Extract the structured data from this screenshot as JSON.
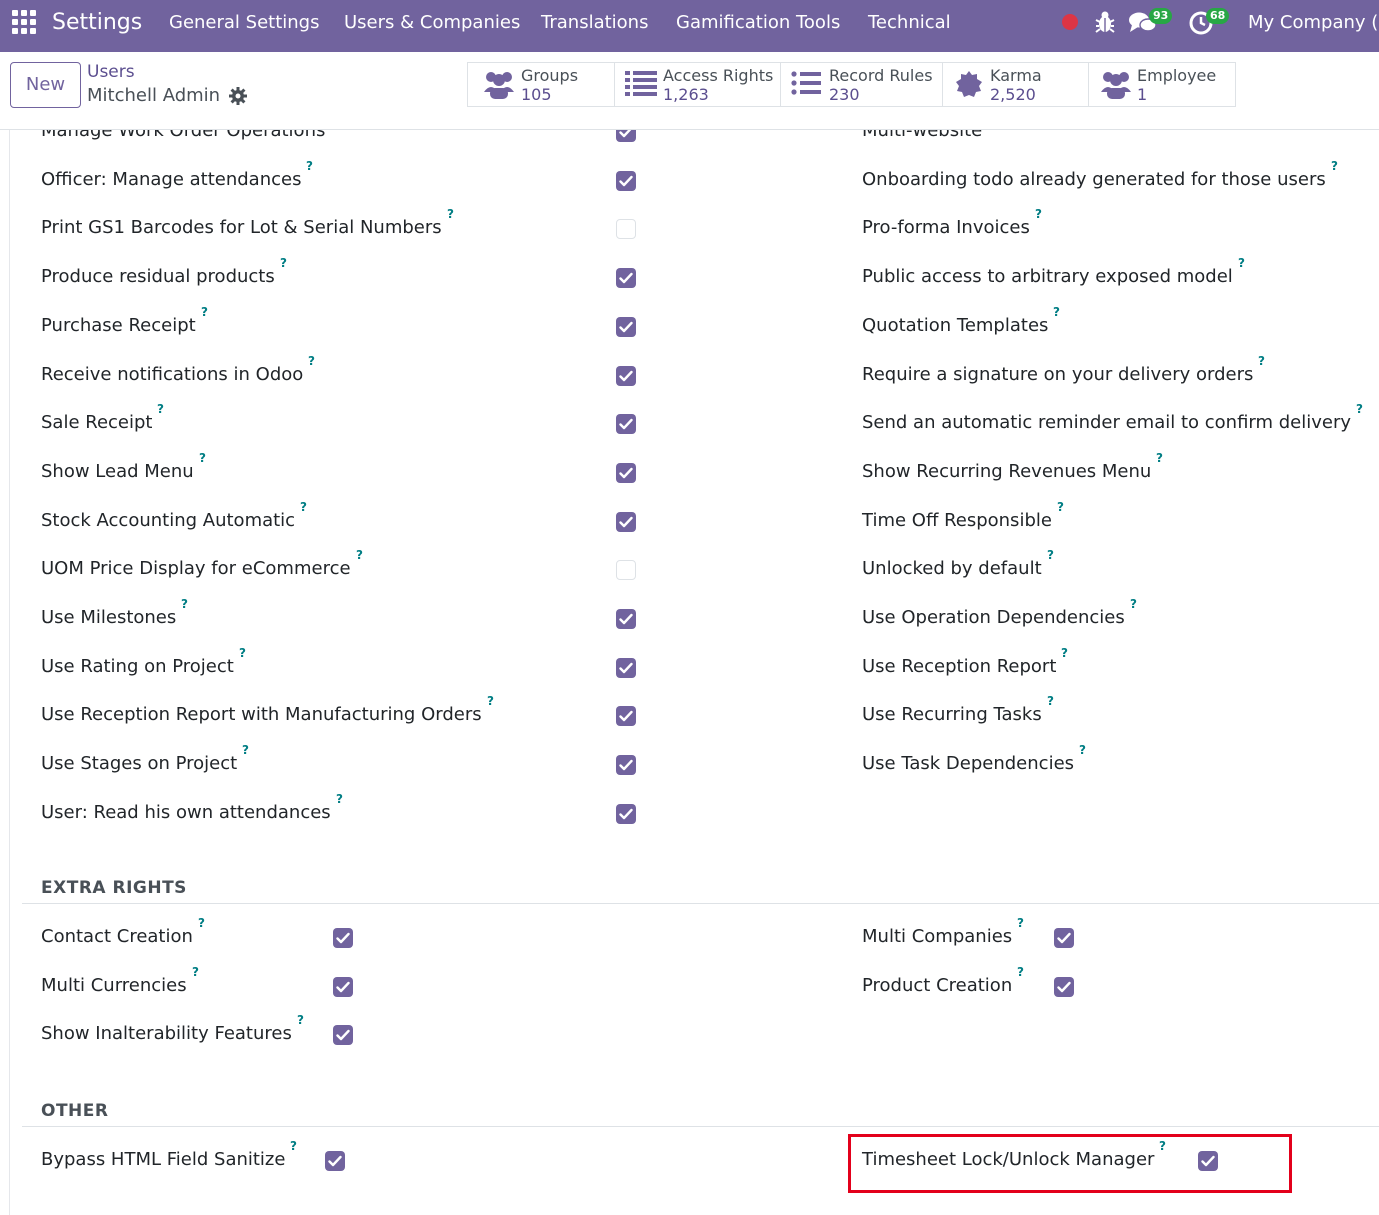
{
  "navbar": {
    "brand": "Settings",
    "menu": [
      "General Settings",
      "Users & Companies",
      "Translations",
      "Gamification Tools",
      "Technical"
    ],
    "messages_count": "93",
    "activities_count": "68",
    "company": "My Company (San Francisco)",
    "colors": {
      "bar": "#71639e",
      "badge": "#28a745",
      "record": "#dc3545"
    },
    "icons": [
      "apps-grid-icon",
      "record-icon",
      "bug-icon",
      "chat-icon",
      "activity-clock-icon"
    ]
  },
  "control": {
    "new_label": "New",
    "breadcrumb_parent": "Users",
    "breadcrumb_current": "Mitchell Admin",
    "stats": [
      {
        "label": "Groups",
        "value": "105",
        "icon": "users-icon"
      },
      {
        "label": "Access Rights",
        "value": "1,263",
        "icon": "list-icon"
      },
      {
        "label": "Record Rules",
        "value": "230",
        "icon": "list-icon"
      },
      {
        "label": "Karma",
        "value": "2,520",
        "icon": "badge-icon"
      },
      {
        "label": "Employee",
        "value": "1",
        "icon": "users-icon"
      }
    ]
  },
  "technical": {
    "left": [
      {
        "label": "Manage Work Order Operations",
        "checked": true
      },
      {
        "label": "Officer: Manage attendances",
        "checked": true
      },
      {
        "label": "Print GS1 Barcodes for Lot & Serial Numbers",
        "checked": false
      },
      {
        "label": "Produce residual products",
        "checked": true
      },
      {
        "label": "Purchase Receipt",
        "checked": true
      },
      {
        "label": "Receive notifications in Odoo",
        "checked": true
      },
      {
        "label": "Sale Receipt",
        "checked": true
      },
      {
        "label": "Show Lead Menu",
        "checked": true
      },
      {
        "label": "Stock Accounting Automatic",
        "checked": true
      },
      {
        "label": "UOM Price Display for eCommerce",
        "checked": false
      },
      {
        "label": "Use Milestones",
        "checked": true
      },
      {
        "label": "Use Rating on Project",
        "checked": true
      },
      {
        "label": "Use Reception Report with Manufacturing Orders",
        "checked": true
      },
      {
        "label": "Use Stages on Project",
        "checked": true
      },
      {
        "label": "User: Read his own attendances",
        "checked": true
      }
    ],
    "right": [
      {
        "label": "Multi-website"
      },
      {
        "label": "Onboarding todo already generated for those users"
      },
      {
        "label": "Pro-forma Invoices"
      },
      {
        "label": "Public access to arbitrary exposed model"
      },
      {
        "label": "Quotation Templates"
      },
      {
        "label": "Require a signature on your delivery orders"
      },
      {
        "label": "Send an automatic reminder email to confirm delivery"
      },
      {
        "label": "Show Recurring Revenues Menu"
      },
      {
        "label": "Time Off Responsible"
      },
      {
        "label": "Unlocked by default"
      },
      {
        "label": "Use Operation Dependencies"
      },
      {
        "label": "Use Reception Report"
      },
      {
        "label": "Use Recurring Tasks"
      },
      {
        "label": "Use Task Dependencies"
      }
    ]
  },
  "extra_rights": {
    "title": "EXTRA RIGHTS",
    "left": [
      {
        "label": "Contact Creation",
        "checked": true
      },
      {
        "label": "Multi Currencies",
        "checked": true
      },
      {
        "label": "Show Inalterability Features",
        "checked": true
      }
    ],
    "right": [
      {
        "label": "Multi Companies",
        "checked": true
      },
      {
        "label": "Product Creation",
        "checked": true
      }
    ]
  },
  "other": {
    "title": "OTHER",
    "left": [
      {
        "label": "Bypass HTML Field Sanitize",
        "checked": true
      }
    ],
    "right": [
      {
        "label": "Timesheet Lock/Unlock Manager",
        "checked": true,
        "highlighted": true
      }
    ]
  },
  "help_mark": "?",
  "colors": {
    "checkbox": "#71639e",
    "help": "#017e84",
    "highlight_border": "#e3001b"
  }
}
